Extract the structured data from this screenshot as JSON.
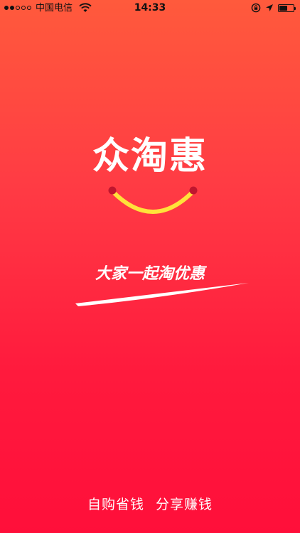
{
  "status_bar": {
    "carrier": "中国电信",
    "time": "14:33",
    "signal_bars_filled": 2,
    "signal_bars_total": 5,
    "battery_level": 0.6
  },
  "logo": {
    "text": "众淘惠"
  },
  "slogan": {
    "text": "大家一起淘优惠"
  },
  "footer": {
    "left": "自购省钱",
    "right": "分享赚钱"
  },
  "colors": {
    "background_top": "#ff5a3c",
    "background_bottom": "#ff0f3a",
    "smile": "#ffe23a",
    "smile_ends": "#c0162e",
    "text": "#ffffff"
  },
  "icons": [
    "signal-icon",
    "wifi-icon",
    "rotation-lock-icon",
    "location-arrow-icon",
    "battery-icon",
    "smile-logo-icon"
  ]
}
